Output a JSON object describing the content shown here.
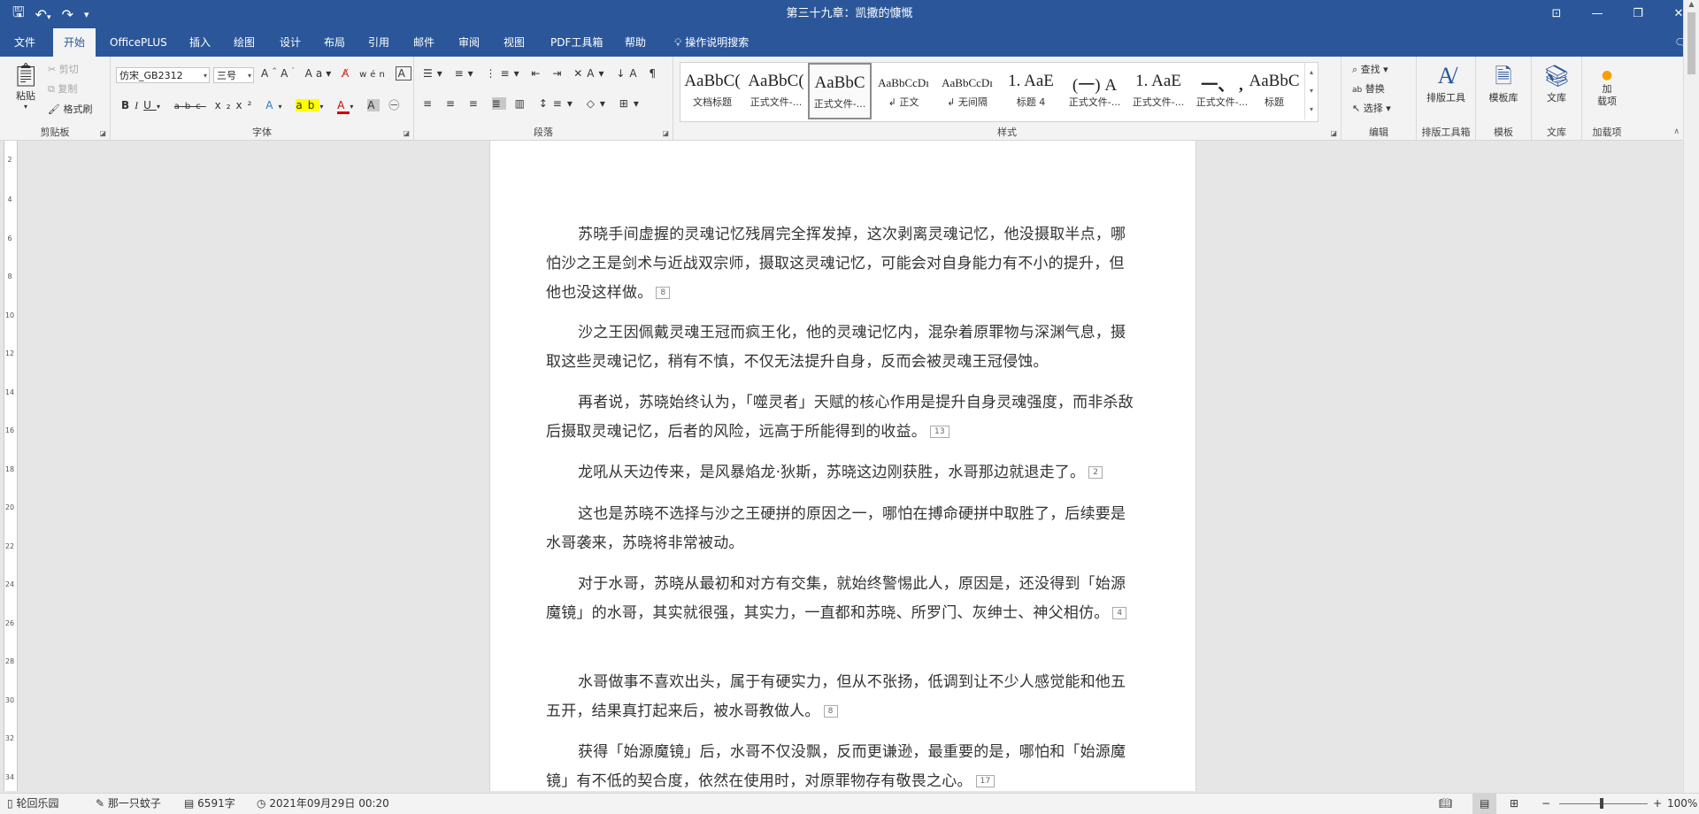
{
  "window": {
    "title": "第三十九章：凯撒的慷慨",
    "controls": [
      "⊡",
      "—",
      "❐",
      "✕"
    ]
  },
  "tabs": [
    {
      "label": "文件"
    },
    {
      "label": "开始",
      "active": true
    },
    {
      "label": "OfficePLUS"
    },
    {
      "label": "插入"
    },
    {
      "label": "绘图"
    },
    {
      "label": "设计"
    },
    {
      "label": "布局"
    },
    {
      "label": "引用"
    },
    {
      "label": "邮件"
    },
    {
      "label": "审阅"
    },
    {
      "label": "视图"
    },
    {
      "label": "PDF工具箱"
    },
    {
      "label": "帮助"
    },
    {
      "label": "操作说明搜索"
    }
  ],
  "ribbon": {
    "clipboard": {
      "paste": "粘贴",
      "cut": "剪切",
      "copy": "复制",
      "format_painter": "格式刷",
      "label": "剪贴板"
    },
    "font": {
      "font_name": "仿宋_GB2312",
      "font_size": "三号",
      "label": "字体"
    },
    "paragraph": {
      "label": "段落"
    },
    "styles": {
      "label": "样式",
      "items": [
        {
          "sample": "AaBbC(",
          "name": "文档标题"
        },
        {
          "sample": "AaBbC(",
          "name": "正式文件-..."
        },
        {
          "sample": "AaBbC",
          "name": "正式文件-...",
          "selected": true
        },
        {
          "sample": "AaBbCcDı",
          "name": "↲ 正文"
        },
        {
          "sample": "AaBbCcDı",
          "name": "↲ 无间隔"
        },
        {
          "sample": "1. AaE",
          "name": "标题 4"
        },
        {
          "sample": "(一) A",
          "name": "正式文件-..."
        },
        {
          "sample": "1. AaE",
          "name": "正式文件-..."
        },
        {
          "sample": "一、 ,",
          "name": "正式文件-..."
        },
        {
          "sample": "AaBbC",
          "name": "标题"
        }
      ]
    },
    "editing": {
      "find": "查找",
      "replace": "替换",
      "select": "选择",
      "label": "编辑"
    },
    "typesetting": {
      "button": "排版工具",
      "label": "排版工具箱"
    },
    "template": {
      "button": "模板库",
      "label": "模板"
    },
    "library": {
      "button": "文库",
      "label": "文库"
    },
    "addins": {
      "button": "加\n载项",
      "label": "加载项"
    }
  },
  "ruler_numbers": [
    "2",
    "4",
    "6",
    "8",
    "10",
    "12",
    "14",
    "16",
    "18",
    "20",
    "22",
    "24",
    "26",
    "28",
    "30",
    "32",
    "34"
  ],
  "document": {
    "paragraphs": [
      {
        "text": "苏晓手间虚握的灵魂记忆残屑完全挥发掉，这次剥离灵魂记忆，他没摄取半点，哪怕沙之王是剑术与近战双宗师，摄取这灵魂记忆，可能会对自身能力有不小的提升，但他也没这样做。",
        "comment": "8"
      },
      {
        "text": "沙之王因佩戴灵魂王冠而疯王化，他的灵魂记忆内，混杂着原罪物与深渊气息，摄取这些灵魂记忆，稍有不慎，不仅无法提升自身，反而会被灵魂王冠侵蚀。",
        "comment": ""
      },
      {
        "text": "再者说，苏晓始终认为，「噬灵者」天赋的核心作用是提升自身灵魂强度，而非杀敌后摄取灵魂记忆，后者的风险，远高于所能得到的收益。",
        "comment": "13"
      },
      {
        "text": "龙吼从天边传来，是风暴焰龙·狄斯，苏晓这边刚获胜，水哥那边就退走了。",
        "comment": "2"
      },
      {
        "text": "这也是苏晓不选择与沙之王硬拼的原因之一，哪怕在搏命硬拼中取胜了，后续要是水哥袭来，苏晓将非常被动。",
        "comment": ""
      },
      {
        "text": "对于水哥，苏晓从最初和对方有交集，就始终警惕此人，原因是，还没得到「始源魔镜」的水哥，其实就很强，其实力，一直都和苏晓、所罗门、灰绅士、神父相仿。",
        "comment": "4"
      },
      {
        "text": "水哥做事不喜欢出头，属于有硬实力，但从不张扬，低调到让不少人感觉能和他五五开，结果真打起来后，被水哥教做人。",
        "comment": "8"
      },
      {
        "text": "获得「始源魔镜」后，水哥不仅没飘，反而更谦逊，最重要的是，哪怕和「始源魔镜」有不低的契合度，依然在使用时，对原罪物存有敬畏之心。",
        "comment": "17"
      }
    ]
  },
  "status": {
    "section": "轮回乐园",
    "author": "那一只蚊子",
    "word_count": "6591字",
    "datetime": "2021年09月29日 00:20",
    "zoom": "100%"
  }
}
